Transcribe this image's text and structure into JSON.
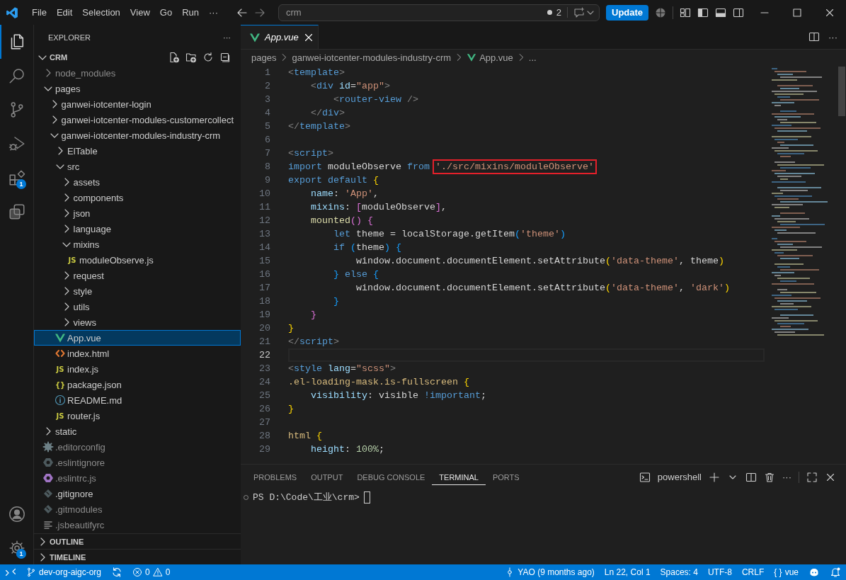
{
  "title_bar": {
    "menus": [
      "File",
      "Edit",
      "Selection",
      "View",
      "Go",
      "Run",
      "···"
    ],
    "command_center": "crm",
    "changes_count": "2",
    "update_button": "Update"
  },
  "activity_bar": {
    "items": [
      {
        "kind": "explorer",
        "selected": true
      },
      {
        "kind": "search",
        "selected": false
      },
      {
        "kind": "source_control",
        "selected": false
      },
      {
        "kind": "run_debug",
        "selected": false
      },
      {
        "kind": "extensions",
        "selected": false,
        "badge": "1"
      },
      {
        "kind": "remote_explorer",
        "selected": false
      }
    ],
    "bottom": [
      {
        "kind": "account"
      },
      {
        "kind": "settings",
        "badge": "1"
      }
    ]
  },
  "explorer": {
    "title": "EXPLORER",
    "more": "···",
    "root": {
      "label": "CRM",
      "expanded": true
    },
    "tree": [
      {
        "label": "node_modules",
        "kind": "folder",
        "expanded": false,
        "selected": false,
        "dimmed": true
      },
      {
        "label": "pages",
        "kind": "folder",
        "expanded": true,
        "selected": false,
        "dimmed": false,
        "children": [
          {
            "label": "ganwei-iotcenter-login",
            "kind": "folder",
            "expanded": false,
            "selected": false,
            "dimmed": false
          },
          {
            "label": "ganwei-iotcenter-modules-customercollect",
            "kind": "folder",
            "expanded": false,
            "selected": false,
            "dimmed": false
          },
          {
            "label": "ganwei-iotcenter-modules-industry-crm",
            "kind": "folder",
            "expanded": true,
            "selected": false,
            "dimmed": false,
            "children": [
              {
                "label": "ElTable",
                "kind": "folder",
                "expanded": false,
                "selected": false,
                "dimmed": false
              },
              {
                "label": "src",
                "kind": "folder",
                "expanded": true,
                "selected": false,
                "dimmed": false,
                "children": [
                  {
                    "label": "assets",
                    "kind": "folder",
                    "expanded": false,
                    "selected": false,
                    "dimmed": false
                  },
                  {
                    "label": "components",
                    "kind": "folder",
                    "expanded": false,
                    "selected": false,
                    "dimmed": false
                  },
                  {
                    "label": "json",
                    "kind": "folder",
                    "expanded": false,
                    "selected": false,
                    "dimmed": false
                  },
                  {
                    "label": "language",
                    "kind": "folder",
                    "expanded": false,
                    "selected": false,
                    "dimmed": false
                  },
                  {
                    "label": "mixins",
                    "kind": "folder",
                    "expanded": true,
                    "selected": false,
                    "dimmed": false,
                    "children": [
                      {
                        "label": "moduleObserve.js",
                        "kind": "js",
                        "glyph": "JS",
                        "selected": false,
                        "dimmed": false
                      }
                    ]
                  },
                  {
                    "label": "request",
                    "kind": "folder",
                    "expanded": false,
                    "selected": false,
                    "dimmed": false
                  },
                  {
                    "label": "style",
                    "kind": "folder",
                    "expanded": false,
                    "selected": false,
                    "dimmed": false
                  },
                  {
                    "label": "utils",
                    "kind": "folder",
                    "expanded": false,
                    "selected": false,
                    "dimmed": false
                  },
                  {
                    "label": "views",
                    "kind": "folder",
                    "expanded": false,
                    "selected": false,
                    "dimmed": false
                  }
                ]
              },
              {
                "label": "App.vue",
                "kind": "vue",
                "selected": true,
                "dimmed": false
              },
              {
                "label": "index.html",
                "kind": "html",
                "selected": false,
                "dimmed": false
              },
              {
                "label": "index.js",
                "kind": "js",
                "glyph": "JS",
                "selected": false,
                "dimmed": false
              },
              {
                "label": "package.json",
                "kind": "json",
                "glyph": "{}",
                "selected": false,
                "dimmed": false
              },
              {
                "label": "README.md",
                "kind": "info",
                "selected": false,
                "dimmed": false
              },
              {
                "label": "router.js",
                "kind": "js",
                "glyph": "JS",
                "selected": false,
                "dimmed": false
              }
            ]
          }
        ]
      },
      {
        "label": "static",
        "kind": "folder",
        "expanded": false,
        "selected": false,
        "dimmed": false
      },
      {
        "label": ".editorconfig",
        "kind": "gear",
        "selected": false,
        "dimmed": true
      },
      {
        "label": ".eslintignore",
        "kind": "eslintignore",
        "selected": false,
        "dimmed": true
      },
      {
        "label": ".eslintrc.js",
        "kind": "eslintrc",
        "selected": false,
        "dimmed": true
      },
      {
        "label": ".gitignore",
        "kind": "git",
        "selected": false,
        "dimmed": false
      },
      {
        "label": ".gitmodules",
        "kind": "git",
        "selected": false,
        "dimmed": true
      },
      {
        "label": ".jsbeautifyrc",
        "kind": "lines",
        "selected": false,
        "dimmed": true
      }
    ],
    "sections": [
      {
        "label": "OUTLINE",
        "expanded": false
      },
      {
        "label": "TIMELINE",
        "expanded": false
      }
    ]
  },
  "editor": {
    "tabs": [
      {
        "label": "App.vue",
        "selected": true,
        "preview": true
      }
    ],
    "more": "···",
    "breadcrumb": [
      "pages",
      "ganwei-iotcenter-modules-industry-crm",
      "App.vue",
      "..."
    ],
    "lines": [
      {
        "number": "1",
        "current": false,
        "tokens": [
          {
            "text": "<",
            "kind": "punct"
          },
          {
            "text": "template",
            "kind": "tag"
          },
          {
            "text": ">",
            "kind": "punct"
          }
        ]
      },
      {
        "number": "2",
        "current": false,
        "tokens": [
          {
            "text": "    <",
            "kind": "punct"
          },
          {
            "text": "div",
            "kind": "tag"
          },
          {
            "text": " id",
            "kind": "attr"
          },
          {
            "text": "=",
            "kind": "plain"
          },
          {
            "text": "\"app\"",
            "kind": "str"
          },
          {
            "text": ">",
            "kind": "punct"
          }
        ]
      },
      {
        "number": "3",
        "current": false,
        "tokens": [
          {
            "text": "        <",
            "kind": "punct"
          },
          {
            "text": "router-view",
            "kind": "tag"
          },
          {
            "text": " />",
            "kind": "punct"
          }
        ]
      },
      {
        "number": "4",
        "current": false,
        "tokens": [
          {
            "text": "    </",
            "kind": "punct"
          },
          {
            "text": "div",
            "kind": "tag"
          },
          {
            "text": ">",
            "kind": "punct"
          }
        ]
      },
      {
        "number": "5",
        "current": false,
        "tokens": [
          {
            "text": "</",
            "kind": "punct"
          },
          {
            "text": "template",
            "kind": "tag"
          },
          {
            "text": ">",
            "kind": "punct"
          }
        ]
      },
      {
        "number": "6",
        "current": false
      },
      {
        "number": "7",
        "current": false,
        "tokens": [
          {
            "text": "<",
            "kind": "punct"
          },
          {
            "text": "script",
            "kind": "tag"
          },
          {
            "text": ">",
            "kind": "punct"
          }
        ]
      },
      {
        "number": "8",
        "current": false,
        "tokens": [
          {
            "text": "import",
            "kind": "kw"
          },
          {
            "text": " moduleObserve ",
            "kind": "plain"
          },
          {
            "text": "from ",
            "kind": "kw"
          },
          {
            "text": "'./src/mixins/moduleObserve'",
            "kind": "str",
            "annotated": true
          }
        ]
      },
      {
        "number": "9",
        "current": false,
        "tokens": [
          {
            "text": "export default ",
            "kind": "kw"
          },
          {
            "text": "{",
            "kind": "b1"
          }
        ]
      },
      {
        "number": "10",
        "current": false,
        "tokens": [
          {
            "text": "    name",
            "kind": "prop"
          },
          {
            "text": ": ",
            "kind": "plain"
          },
          {
            "text": "'App'",
            "kind": "str"
          },
          {
            "text": ",",
            "kind": "plain"
          }
        ]
      },
      {
        "number": "11",
        "current": false,
        "tokens": [
          {
            "text": "    mixins",
            "kind": "prop"
          },
          {
            "text": ": ",
            "kind": "plain"
          },
          {
            "text": "[",
            "kind": "b2"
          },
          {
            "text": "moduleObserve",
            "kind": "plain"
          },
          {
            "text": "]",
            "kind": "b2"
          },
          {
            "text": ",",
            "kind": "plain"
          }
        ]
      },
      {
        "number": "12",
        "current": false,
        "tokens": [
          {
            "text": "    mounted",
            "kind": "fn"
          },
          {
            "text": "()",
            "kind": "b2"
          },
          {
            "text": " {",
            "kind": "b2"
          }
        ]
      },
      {
        "number": "13",
        "current": false,
        "tokens": [
          {
            "text": "        let",
            "kind": "kw"
          },
          {
            "text": " theme = localStorage.getItem",
            "kind": "plain"
          },
          {
            "text": "(",
            "kind": "b3"
          },
          {
            "text": "'theme'",
            "kind": "str"
          },
          {
            "text": ")",
            "kind": "b3"
          }
        ]
      },
      {
        "number": "14",
        "current": false,
        "tokens": [
          {
            "text": "        if",
            "kind": "kw"
          },
          {
            "text": " (",
            "kind": "b3"
          },
          {
            "text": "theme",
            "kind": "plain"
          },
          {
            "text": ")",
            "kind": "b3"
          },
          {
            "text": " {",
            "kind": "b3"
          }
        ]
      },
      {
        "number": "15",
        "current": false,
        "tokens": [
          {
            "text": "            window.document.documentElement.setAttribute",
            "kind": "plain"
          },
          {
            "text": "(",
            "kind": "b1"
          },
          {
            "text": "'data-theme'",
            "kind": "str"
          },
          {
            "text": ", theme",
            "kind": "plain"
          },
          {
            "text": ")",
            "kind": "b1"
          }
        ]
      },
      {
        "number": "16",
        "current": false,
        "tokens": [
          {
            "text": "        }",
            "kind": "b3"
          },
          {
            "text": " else",
            "kind": "kw"
          },
          {
            "text": " {",
            "kind": "b3"
          }
        ]
      },
      {
        "number": "17",
        "current": false,
        "tokens": [
          {
            "text": "            window.document.documentElement.setAttribute",
            "kind": "plain"
          },
          {
            "text": "(",
            "kind": "b1"
          },
          {
            "text": "'data-theme'",
            "kind": "str"
          },
          {
            "text": ", ",
            "kind": "plain"
          },
          {
            "text": "'dark'",
            "kind": "str"
          },
          {
            "text": ")",
            "kind": "b1"
          }
        ]
      },
      {
        "number": "18",
        "current": false,
        "tokens": [
          {
            "text": "        }",
            "kind": "b3"
          }
        ]
      },
      {
        "number": "19",
        "current": false,
        "tokens": [
          {
            "text": "    }",
            "kind": "b2"
          }
        ]
      },
      {
        "number": "20",
        "current": false,
        "tokens": [
          {
            "text": "}",
            "kind": "b1"
          }
        ]
      },
      {
        "number": "21",
        "current": false,
        "tokens": [
          {
            "text": "</",
            "kind": "punct"
          },
          {
            "text": "script",
            "kind": "tag"
          },
          {
            "text": ">",
            "kind": "punct"
          }
        ]
      },
      {
        "number": "22",
        "current": true
      },
      {
        "number": "23",
        "current": false,
        "tokens": [
          {
            "text": "<",
            "kind": "punct"
          },
          {
            "text": "style",
            "kind": "tag"
          },
          {
            "text": " lang",
            "kind": "attr"
          },
          {
            "text": "=",
            "kind": "plain"
          },
          {
            "text": "\"scss\"",
            "kind": "str"
          },
          {
            "text": ">",
            "kind": "punct"
          }
        ]
      },
      {
        "number": "24",
        "current": false,
        "tokens": [
          {
            "text": ".el-loading-mask.is-fullscreen",
            "kind": "sel"
          },
          {
            "text": " {",
            "kind": "b1"
          }
        ]
      },
      {
        "number": "25",
        "current": false,
        "tokens": [
          {
            "text": "    visibility",
            "kind": "prop"
          },
          {
            "text": ": visible ",
            "kind": "plain"
          },
          {
            "text": "!important",
            "kind": "kw"
          },
          {
            "text": ";",
            "kind": "plain"
          }
        ]
      },
      {
        "number": "26",
        "current": false,
        "tokens": [
          {
            "text": "}",
            "kind": "b1"
          }
        ]
      },
      {
        "number": "27",
        "current": false
      },
      {
        "number": "28",
        "current": false,
        "tokens": [
          {
            "text": "html",
            "kind": "sel"
          },
          {
            "text": " {",
            "kind": "b1"
          }
        ]
      },
      {
        "number": "29",
        "current": false,
        "tokens": [
          {
            "text": "    height",
            "kind": "prop"
          },
          {
            "text": ": ",
            "kind": "plain"
          },
          {
            "text": "100%",
            "kind": "num"
          },
          {
            "text": ";",
            "kind": "plain"
          }
        ]
      }
    ]
  },
  "panel": {
    "tabs": [
      {
        "label": "PROBLEMS",
        "selected": false
      },
      {
        "label": "OUTPUT",
        "selected": false
      },
      {
        "label": "DEBUG CONSOLE",
        "selected": false
      },
      {
        "label": "TERMINAL",
        "selected": true
      },
      {
        "label": "PORTS",
        "selected": false
      }
    ],
    "terminal_name": "powershell",
    "more": "···",
    "prompt": "PS D:\\Code\\工业\\crm>"
  },
  "status_bar": {
    "left": [
      {
        "kind": "remote"
      },
      {
        "kind": "branch",
        "text": "dev-org-aigc-org"
      },
      {
        "kind": "sync"
      },
      {
        "kind": "problems",
        "errors": "0",
        "warnings": "0"
      }
    ],
    "right": [
      {
        "kind": "blame",
        "text": "YAO (9 months ago)"
      },
      {
        "kind": "text",
        "text": "Ln 22, Col 1"
      },
      {
        "kind": "text",
        "text": "Spaces: 4"
      },
      {
        "kind": "text",
        "text": "UTF-8"
      },
      {
        "kind": "text",
        "text": "CRLF"
      },
      {
        "kind": "language",
        "glyph": "{ }",
        "text": "vue"
      },
      {
        "kind": "copilot"
      },
      {
        "kind": "bell"
      }
    ]
  }
}
